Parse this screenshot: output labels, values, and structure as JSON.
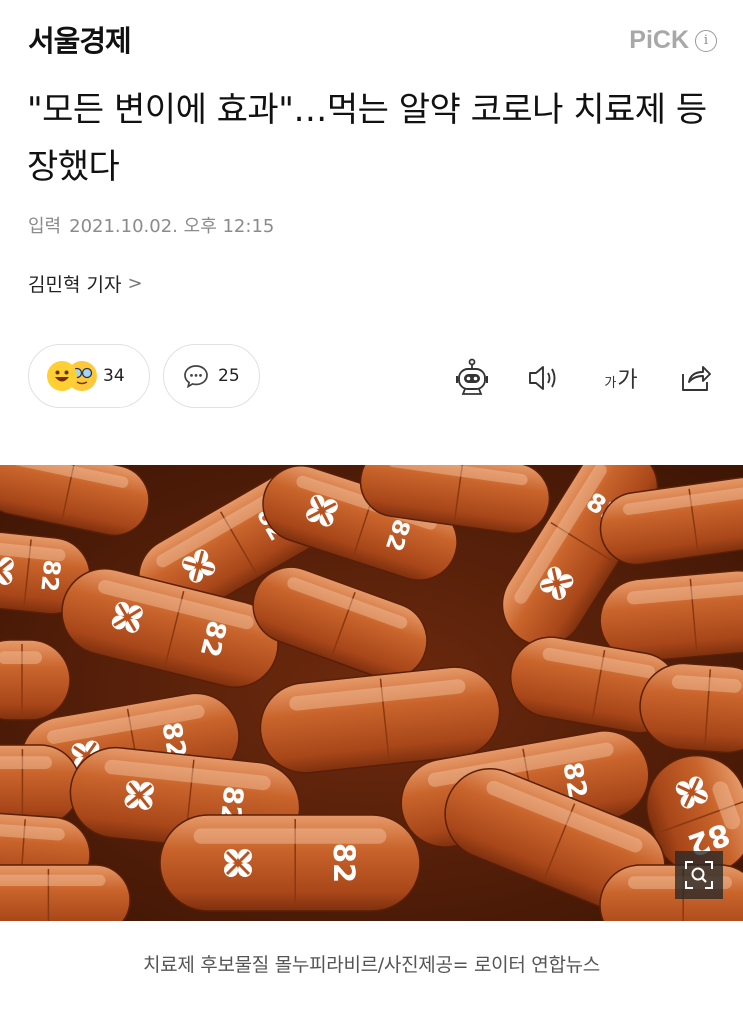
{
  "header": {
    "press_name": "서울경제",
    "pick_label": "PiCK",
    "info_glyph": "i"
  },
  "article": {
    "headline": "\"모든 변이에 효과\"…먹는 알약 코로나 치료제 등장했다",
    "published_label": "입력",
    "published_time": "2021.10.02. 오후 12:15",
    "reporter": "김민혁 기자",
    "reporter_chevron": ">"
  },
  "actions": {
    "reaction_count": "34",
    "comment_count": "25",
    "font_size_small": "가",
    "font_size_large": "가",
    "icons": [
      "robot-summary-icon",
      "speaker-icon",
      "font-size-icon",
      "share-icon"
    ]
  },
  "photo": {
    "pill_print_text": "82",
    "caption": "치료제 후보물질 몰누피라비르/사진제공= 로이터 연합뉴스"
  },
  "colors": {
    "capsule": "#b8521e",
    "capsule_highlight": "#e69a6a",
    "background": "#5a1f08",
    "pick_gray": "#a8a8a8"
  }
}
